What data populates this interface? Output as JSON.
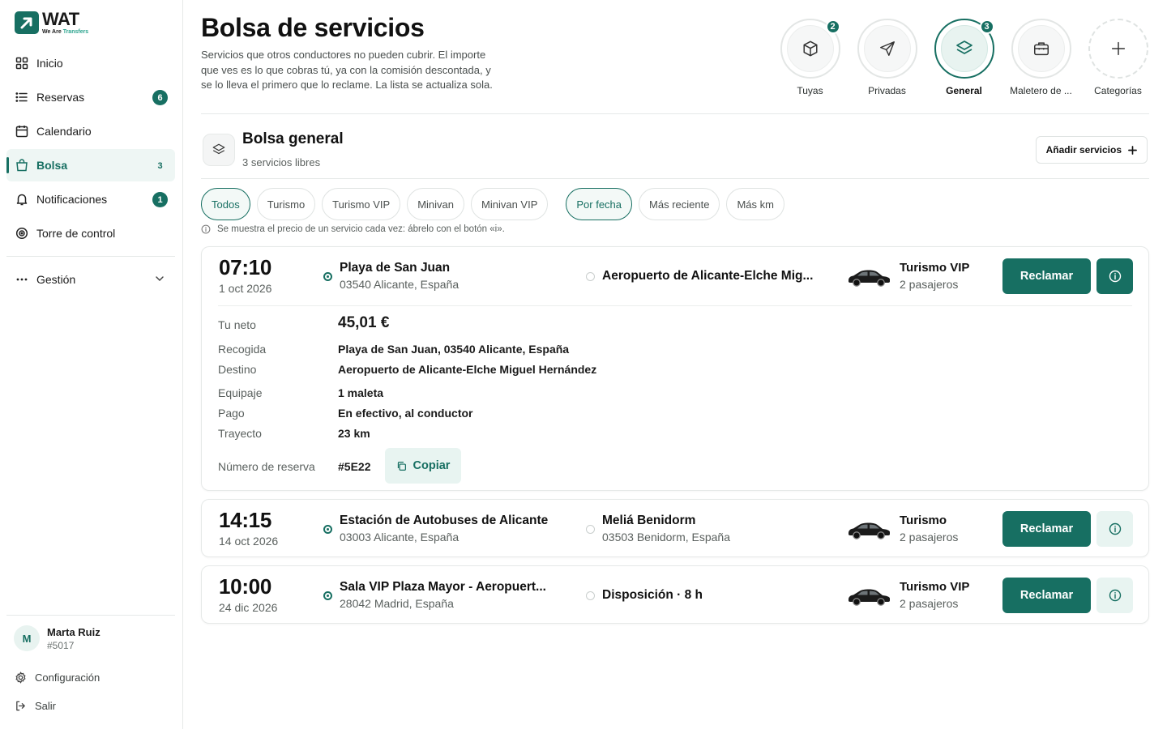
{
  "brand": {
    "name": "WAT",
    "tagline_a": "We Are",
    "tagline_b": "Transfers",
    "accent": "#176f62"
  },
  "sidebar": {
    "items": [
      {
        "label": "Inicio",
        "icon": "grid-icon"
      },
      {
        "label": "Reservas",
        "icon": "list-icon",
        "badge": "6"
      },
      {
        "label": "Calendario",
        "icon": "calendar-icon"
      },
      {
        "label": "Bolsa",
        "icon": "bag-icon",
        "badge": "3",
        "active": true
      },
      {
        "label": "Notificaciones",
        "icon": "bell-icon",
        "badge": "1"
      },
      {
        "label": "Torre de control",
        "icon": "target-icon"
      }
    ],
    "gestion": "Gestión",
    "user": {
      "initial": "M",
      "name": "Marta Ruiz",
      "id": "#5017"
    },
    "config": "Configuración",
    "logout": "Salir"
  },
  "header": {
    "title": "Bolsa de servicios",
    "description": "Servicios que otros conductores no pueden cubrir. El importe que ves es lo que cobras tú, ya con la comisión descontada, y se lo lleva el primero que lo reclame. La lista se actualiza sola."
  },
  "categories": [
    {
      "label": "Tuyas",
      "icon": "box-icon",
      "badge": "2"
    },
    {
      "label": "Privadas",
      "icon": "send-icon"
    },
    {
      "label": "General",
      "icon": "layers-icon",
      "badge": "3",
      "active": true
    },
    {
      "label": "Maletero de ...",
      "icon": "suitcase-icon"
    },
    {
      "label": "Categorías",
      "icon": "plus-icon"
    }
  ],
  "section": {
    "title": "Bolsa general",
    "subtitle": "3 servicios libres",
    "add_label": "Añadir servicios"
  },
  "filters": {
    "types": [
      "Todos",
      "Turismo",
      "Turismo VIP",
      "Minivan",
      "Minivan VIP"
    ],
    "sorts": [
      "Por fecha",
      "Más reciente",
      "Más km"
    ]
  },
  "note": "Se muestra el precio de un servicio cada vez: ábrelo con el botón «i».",
  "services": [
    {
      "time": "07:10",
      "date": "1 oct 2026",
      "from": "Playa de San Juan",
      "from_sub": "03540 Alicante, España",
      "to": "Aeropuerto de Alicante-Elche Mig...",
      "to_sub": "",
      "vehicle": "Turismo VIP",
      "pax": "2 pasajeros",
      "claim": "Reclamar",
      "details": {
        "neto_label": "Tu neto",
        "neto": "45,01 €",
        "pickup_label": "Recogida",
        "pickup": "Playa de San Juan, 03540 Alicante, España",
        "dest_label": "Destino",
        "dest": "Aeropuerto de Alicante-Elche Miguel Hernández",
        "luggage_label": "Equipaje",
        "luggage": "1 maleta",
        "payment_label": "Pago",
        "payment": "En efectivo, al conductor",
        "route_label": "Trayecto",
        "route": "23 km",
        "booking_label": "Número de reserva",
        "booking": "#5E22",
        "copy_label": "Copiar"
      }
    },
    {
      "time": "14:15",
      "date": "14 oct 2026",
      "from": "Estación de Autobuses de Alicante",
      "from_sub": "03003 Alicante, España",
      "to": "Meliá Benidorm",
      "to_sub": "03503 Benidorm, España",
      "vehicle": "Turismo",
      "pax": "2 pasajeros",
      "claim": "Reclamar"
    },
    {
      "time": "10:00",
      "date": "24 dic 2026",
      "from": "Sala VIP Plaza Mayor - Aeropuert...",
      "from_sub": "28042 Madrid, España",
      "to": "Disposición · 8 h",
      "to_sub": "",
      "vehicle": "Turismo VIP",
      "pax": "2 pasajeros",
      "claim": "Reclamar"
    }
  ]
}
